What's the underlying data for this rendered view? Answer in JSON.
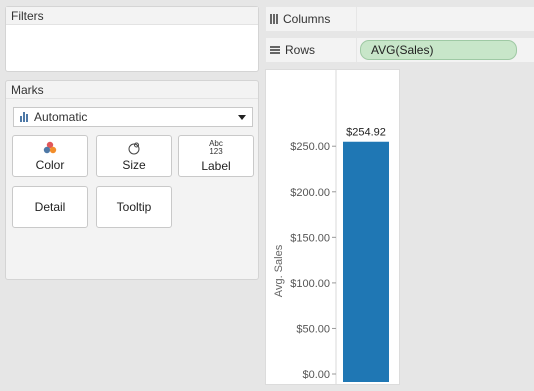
{
  "filters": {
    "title": "Filters"
  },
  "marks": {
    "title": "Marks",
    "mark_type": "Automatic",
    "cards": {
      "color": "Color",
      "size": "Size",
      "label": "Label",
      "label_icon_top": "Abc",
      "label_icon_bottom": "123",
      "detail": "Detail",
      "tooltip": "Tooltip"
    }
  },
  "shelves": {
    "columns_label": "Columns",
    "rows_label": "Rows",
    "rows_pill": "AVG(Sales)"
  },
  "colors": {
    "bar": "#1f77b4",
    "pill": "#c8e6c9"
  },
  "chart_data": {
    "type": "bar",
    "categories": [
      ""
    ],
    "values": [
      254.92
    ],
    "data_labels": [
      "$254.92"
    ],
    "title": "",
    "xlabel": "",
    "ylabel": "Avg. Sales",
    "ylim": [
      0,
      270
    ],
    "yticks": [
      0,
      50,
      100,
      150,
      200,
      250
    ],
    "ytick_labels": [
      "$0.00",
      "$50.00",
      "$100.00",
      "$150.00",
      "$200.00",
      "$250.00"
    ],
    "grid": false
  }
}
